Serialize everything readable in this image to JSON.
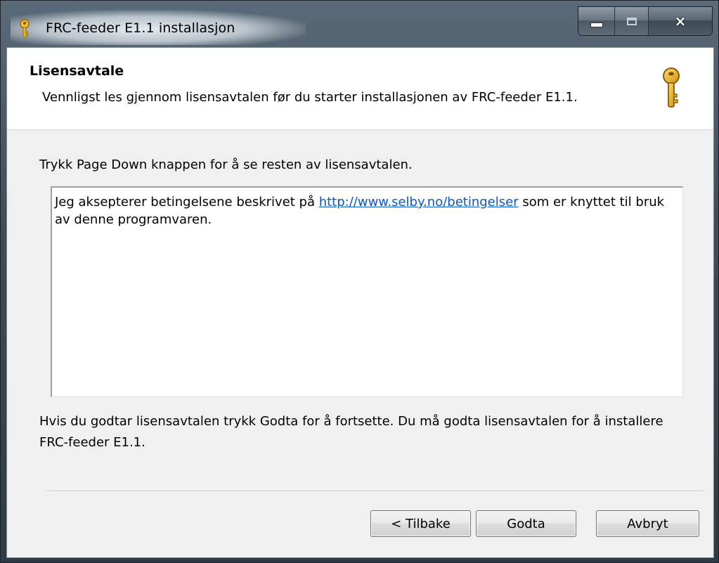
{
  "window": {
    "title": "FRC-feeder E1.1 installasjon",
    "icon": "key-icon",
    "caption_buttons": {
      "minimize": "minimize-icon",
      "maximize": "maximize-icon",
      "close": "×"
    }
  },
  "header": {
    "title": "Lisensavtale",
    "subtitle": "Vennligst les gjennom lisensavtalen før du starter installasjonen av FRC-feeder E1.1.",
    "icon": "key-icon"
  },
  "instruction": "Trykk Page Down knappen for å se resten av lisensavtalen.",
  "license": {
    "text_before": "Jeg aksepterer betingelsene beskrivet på ",
    "link": "http://www.selby.no/betingelser",
    "text_after": " som er knyttet til bruk av denne programvaren."
  },
  "footer_text": "Hvis du godtar lisensavtalen trykk Godta for å fortsette. Du må godta lisensavtalen for å installere FRC-feeder E1.1.",
  "buttons": {
    "back": "< Tilbake",
    "accept": "Godta",
    "cancel": "Avbryt"
  },
  "colors": {
    "link": "#0a58c8",
    "key_gold": "#e8b820",
    "client_bg": "#f0f0f0"
  }
}
